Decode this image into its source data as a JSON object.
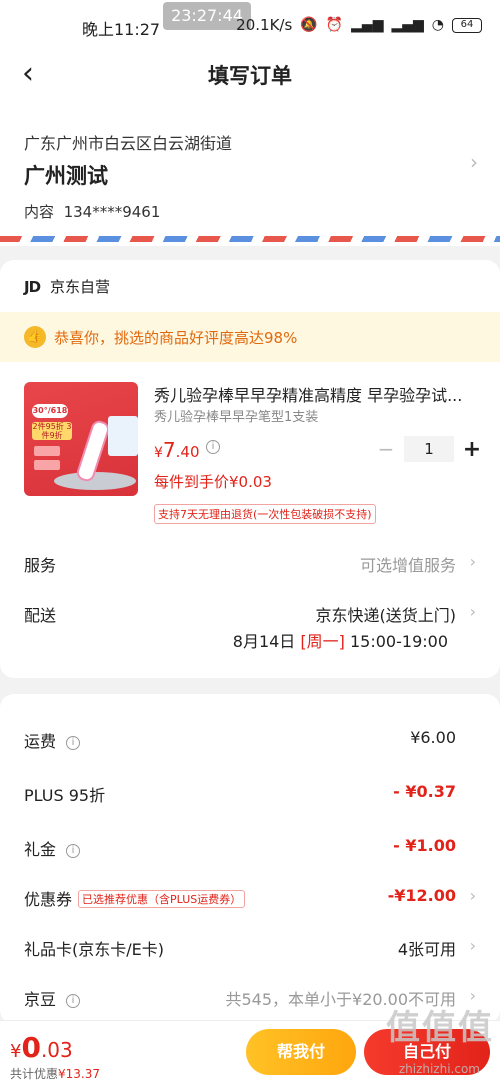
{
  "status_bar": {
    "time": "晚上11:27",
    "clock_overlay": "23:27:44",
    "net_speed": "20.1K/s",
    "battery": "64"
  },
  "nav": {
    "title": "填写订单"
  },
  "address": {
    "region": "广东广州市白云区白云湖街道",
    "name": "广州测试",
    "contact_label": "内容",
    "phone": "134****9461"
  },
  "shop": {
    "logo": "JD",
    "name": "京东自营"
  },
  "praise": {
    "text": "恭喜你，挑选的商品好评度高达98%"
  },
  "product": {
    "image_tag_1": "30°/618",
    "image_tag_2": "2件95折 3件9折",
    "title": "秀儿验孕棒早早孕精准高精度 早孕验孕试...",
    "spec": "秀儿验孕棒早早孕笔型1支装",
    "price_symbol": "¥",
    "price_int": "7",
    "price_dec": ".40",
    "quantity": "1",
    "unit_price_text": "每件到手价¥0.03",
    "return_policy": "支持7天无理由退货(一次性包装破损不支持)"
  },
  "service": {
    "label": "服务",
    "value": "可选增值服务"
  },
  "delivery": {
    "label": "配送",
    "method": "京东快递(送货上门)",
    "date": "8月14日",
    "weekday": "[周一]",
    "time_window": "15:00-19:00"
  },
  "fees": {
    "shipping_label": "运费",
    "shipping_value": "¥6.00",
    "plus_label": "PLUS 95折",
    "plus_value": "- ¥0.37",
    "gift_label": "礼金",
    "gift_value": "- ¥1.00",
    "coupon_label": "优惠券",
    "coupon_tag": "已选推荐优惠（含PLUS运费券）",
    "coupon_value": "-¥12.00",
    "giftcard_label": "礼品卡(京东卡/E卡)",
    "giftcard_value": "4张可用",
    "jingdou_label": "京豆",
    "jingdou_value": "共545，本单小于¥20.00不可用"
  },
  "bottom": {
    "total_symbol": "¥",
    "total_int": "0",
    "total_dec": ".03",
    "discount_label": "共计优惠",
    "discount_value": "¥13.37",
    "help_pay": "帮我付",
    "submit": "自己付"
  },
  "watermark": {
    "main": "值值值",
    "sub": "zhizhizhi.com"
  },
  "colors": {
    "accent_red": "#e2231a",
    "help_yellow": "#ffb31a",
    "praise_bg": "#fff8e0"
  }
}
